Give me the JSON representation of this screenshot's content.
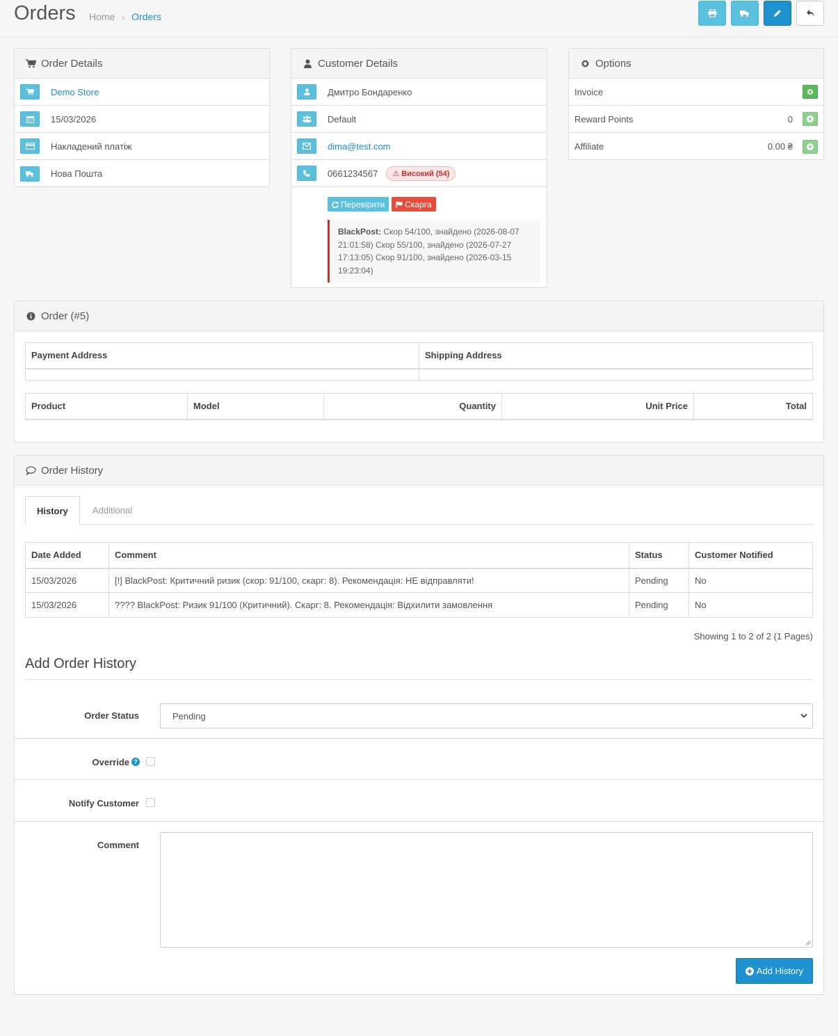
{
  "header": {
    "title": "Orders",
    "breadcrumb": {
      "home": "Home",
      "sep": "›",
      "current": "Orders"
    },
    "buttons": [
      {
        "icon": "print-icon"
      },
      {
        "icon": "truck-icon"
      },
      {
        "icon": "pencil-icon"
      },
      {
        "icon": "reply-icon"
      }
    ]
  },
  "order_details": {
    "title": "Order Details",
    "rows": {
      "store": "Demo Store",
      "date": "15/03/2026",
      "payment": "Накладений платіж",
      "shipping": "Нова Пошта"
    }
  },
  "customer_details": {
    "title": "Customer Details",
    "name": "Дмитро Бондаренко",
    "group": "Default",
    "email": "dima@test.com",
    "phone": "0661234567",
    "risk_badge": "⚠ Високий (54)",
    "check_button": "Перевірити",
    "complaint_button": "Скарга",
    "blackpost_label": "BlackPost:",
    "blackpost_text": " Скор 54/100, знайдено (2026-08-07 21:01:58) Скор 55/100, знайдено (2026-07-27 17:13:05) Скор 91/100, знайдено (2026-03-15 19:23:04)"
  },
  "options": {
    "title": "Options",
    "invoice_label": "Invoice",
    "reward_label": "Reward Points",
    "reward_value": "0",
    "affiliate_label": "Affiliate",
    "affiliate_value": "0.00 ₴"
  },
  "order": {
    "title": "Order (#5)",
    "address_headers": {
      "payment": "Payment Address",
      "shipping": "Shipping Address"
    },
    "product_headers": {
      "product": "Product",
      "model": "Model",
      "quantity": "Quantity",
      "unit_price": "Unit Price",
      "total": "Total"
    }
  },
  "history": {
    "title": "Order History",
    "tabs": {
      "history": "History",
      "additional": "Additional"
    },
    "columns": {
      "date": "Date Added",
      "comment": "Comment",
      "status": "Status",
      "notified": "Customer Notified"
    },
    "rows": [
      {
        "date": "15/03/2026",
        "comment": "[!] BlackPost: Критичний ризик (скор: 91/100, скарг: 8). Рекомендація: НЕ відправляти!",
        "status": "Pending",
        "notified": "No"
      },
      {
        "date": "15/03/2026",
        "comment": "???? BlackPost: Ризик 91/100 (Критичний). Скарг: 8. Рекомендація: Відхилити замовлення",
        "status": "Pending",
        "notified": "No"
      }
    ],
    "pagination": "Showing 1 to 2 of 2 (1 Pages)"
  },
  "add_history": {
    "title": "Add Order History",
    "status_label": "Order Status",
    "status_value": "Pending",
    "override_label": "Override",
    "notify_label": "Notify Customer",
    "comment_label": "Comment",
    "comment_value": "",
    "submit_label": "Add History"
  },
  "colors": {
    "primary": "#1e91cf",
    "info": "#5bc0de",
    "success": "#5cb85c",
    "danger": "#e74c3c"
  }
}
